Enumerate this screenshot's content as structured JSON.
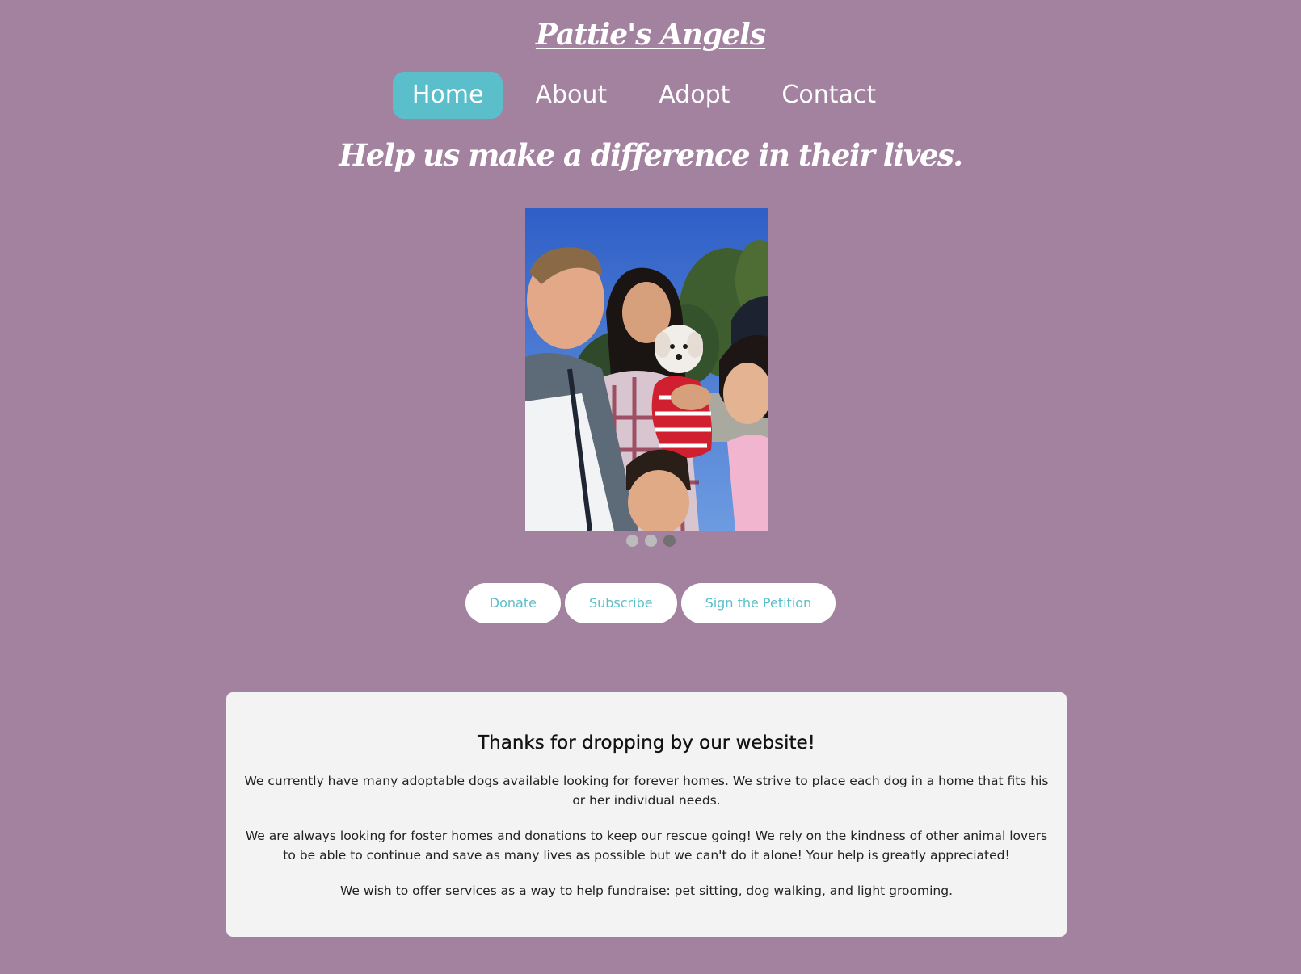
{
  "site": {
    "title": "Pattie's Angels",
    "tagline": "Help us make a difference in their lives."
  },
  "nav": {
    "items": [
      {
        "label": "Home",
        "active": true
      },
      {
        "label": "About",
        "active": false
      },
      {
        "label": "Adopt",
        "active": false
      },
      {
        "label": "Contact",
        "active": false
      }
    ]
  },
  "slideshow": {
    "slide_count": 3,
    "active_index": 2
  },
  "actions": {
    "donate": "Donate",
    "subscribe": "Subscribe",
    "petition": "Sign the Petition"
  },
  "welcome": {
    "heading": "Thanks for dropping by our website!",
    "paragraphs": [
      "We currently have many adoptable dogs available looking for forever homes. We strive to place each dog in a home that fits his or her individual needs.",
      "We are always looking for foster homes and donations to keep our rescue going! We rely on the kindness of other animal lovers to be able to continue and save as many lives as possible but we can't do it alone! Your help is greatly appreciated!",
      "We wish to offer services as a way to help fundraise: pet sitting, dog walking, and light grooming."
    ]
  },
  "colors": {
    "background": "#a2829f",
    "accent": "#5bbfcb",
    "card": "#f3f3f3",
    "dot_inactive": "#bbbbbb",
    "dot_active": "#717171"
  }
}
